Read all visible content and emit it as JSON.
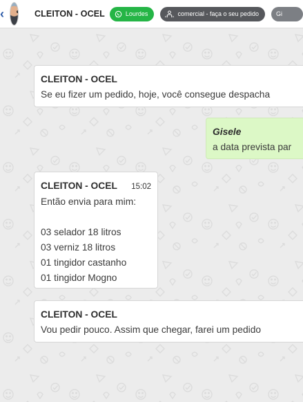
{
  "header": {
    "contact_name": "CLEITON - OCEL",
    "tags": [
      {
        "label": "Lourdes",
        "color": "#25b546",
        "icon": "whatsapp-icon"
      },
      {
        "label": "comercial - faça o seu pedido",
        "color": "#56585c",
        "icon": "people-icon"
      },
      {
        "label": "Gi",
        "color": "#7c7f84"
      }
    ]
  },
  "messages": [
    {
      "sender": "CLEITON - OCEL",
      "lines": [
        "Se eu fizer um pedido, hoje, você consegue despacha"
      ]
    },
    {
      "sender": "Gisele",
      "lines": [
        "a data prevista par"
      ]
    },
    {
      "sender": "CLEITON - OCEL",
      "time": "15:02",
      "lines": [
        "Então envia para mim:",
        "",
        "03 selador 18 litros",
        "03 verniz 18 litros",
        "01 tingidor castanho",
        "01 tingidor Mogno"
      ]
    },
    {
      "sender": "CLEITON - OCEL",
      "lines": [
        "Vou pedir pouco. Assim que chegar, farei um pedido"
      ]
    }
  ],
  "colors": {
    "incoming_bubble": "#ffffff",
    "outgoing_bubble": "#dcf8c6",
    "chat_background": "#ececec"
  }
}
